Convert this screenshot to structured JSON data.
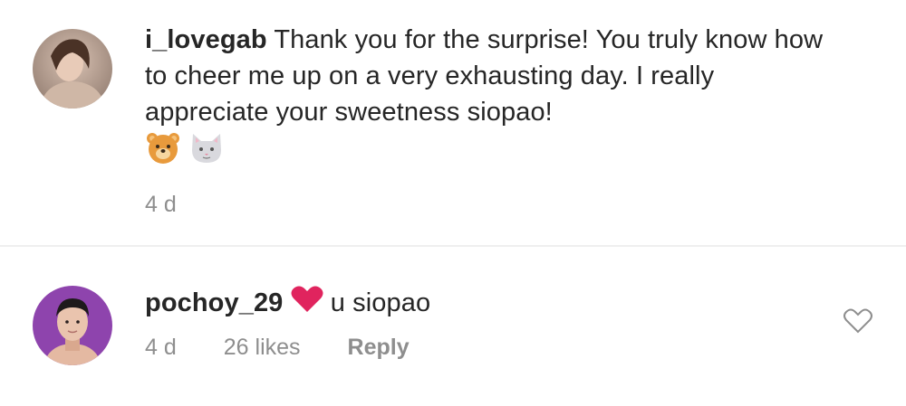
{
  "comments": [
    {
      "username": "i_lovegab",
      "text": "Thank you for the surprise! You truly know how to cheer me up on a very exhausting day. I really appreciate your sweetness siopao!",
      "emojis": [
        "bear-face",
        "cat-face"
      ],
      "time": "4 d"
    },
    {
      "username": "pochoy_29",
      "heart": "heart-emoji",
      "text": "u siopao",
      "time": "4 d",
      "likes": "26 likes",
      "reply": "Reply",
      "like_icon": "heart-outline-icon"
    }
  ],
  "colors": {
    "text": "#262626",
    "meta": "#8e8e8e",
    "divider": "#efefef",
    "heart": "#e0245e"
  }
}
